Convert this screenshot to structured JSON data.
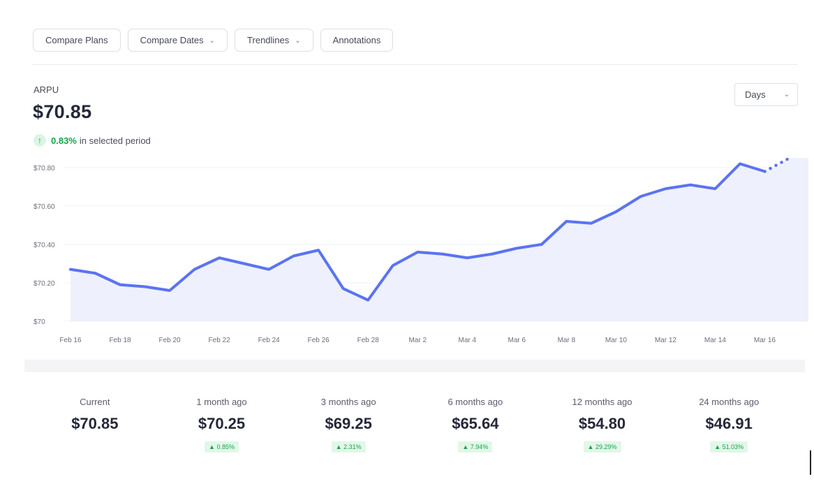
{
  "toolbar": {
    "buttons": [
      {
        "label": "Compare Plans",
        "dropdown": false
      },
      {
        "label": "Compare Dates",
        "dropdown": true
      },
      {
        "label": "Trendlines",
        "dropdown": true
      },
      {
        "label": "Annotations",
        "dropdown": false
      }
    ]
  },
  "metric": {
    "label": "ARPU",
    "value": "$70.85",
    "change_pct": "0.83%",
    "change_text": "in selected period",
    "change_icon": "arrow-up-icon"
  },
  "period_select": {
    "value": "Days"
  },
  "colors": {
    "line": "#5b73f2",
    "area": "#eef1fd",
    "positive": "#16a34a"
  },
  "chart_data": {
    "type": "area",
    "x": [
      "Feb 16",
      "Feb 17",
      "Feb 18",
      "Feb 19",
      "Feb 20",
      "Feb 21",
      "Feb 22",
      "Feb 23",
      "Feb 24",
      "Feb 25",
      "Feb 26",
      "Feb 27",
      "Feb 28",
      "Mar 1",
      "Mar 2",
      "Mar 3",
      "Mar 4",
      "Mar 5",
      "Mar 6",
      "Mar 7",
      "Mar 8",
      "Mar 9",
      "Mar 10",
      "Mar 11",
      "Mar 12",
      "Mar 13",
      "Mar 14",
      "Mar 15",
      "Mar 16",
      "Mar 17"
    ],
    "series": [
      {
        "values": [
          70.27,
          70.25,
          70.19,
          70.18,
          70.16,
          70.27,
          70.33,
          70.3,
          70.27,
          70.34,
          70.37,
          70.17,
          70.11,
          70.29,
          70.36,
          70.35,
          70.33,
          70.35,
          70.38,
          70.4,
          70.52,
          70.51,
          70.57,
          70.65,
          70.69,
          70.71,
          70.69,
          70.82,
          70.78,
          70.85
        ],
        "projected_from_index": 28
      }
    ],
    "x_tick_labels": [
      "Feb 16",
      "Feb 18",
      "Feb 20",
      "Feb 22",
      "Feb 24",
      "Feb 26",
      "Feb 28",
      "Mar 2",
      "Mar 4",
      "Mar 6",
      "Mar 8",
      "Mar 10",
      "Mar 12",
      "Mar 14",
      "Mar 16"
    ],
    "y_ticks": [
      70.0,
      70.2,
      70.4,
      70.6,
      70.8
    ],
    "y_tick_labels": [
      "$70",
      "$70.20",
      "$70.40",
      "$70.60",
      "$70.80"
    ],
    "ylim": [
      70.0,
      70.84
    ],
    "grid": true,
    "title": "",
    "xlabel": "",
    "ylabel": ""
  },
  "stats": [
    {
      "label": "Current",
      "value": "$70.85",
      "change": ""
    },
    {
      "label": "1 month ago",
      "value": "$70.25",
      "change": "0.85%"
    },
    {
      "label": "3 months ago",
      "value": "$69.25",
      "change": "2.31%"
    },
    {
      "label": "6 months ago",
      "value": "$65.64",
      "change": "7.94%"
    },
    {
      "label": "12 months ago",
      "value": "$54.80",
      "change": "29.29%"
    },
    {
      "label": "24 months ago",
      "value": "$46.91",
      "change": "51.03%"
    }
  ]
}
